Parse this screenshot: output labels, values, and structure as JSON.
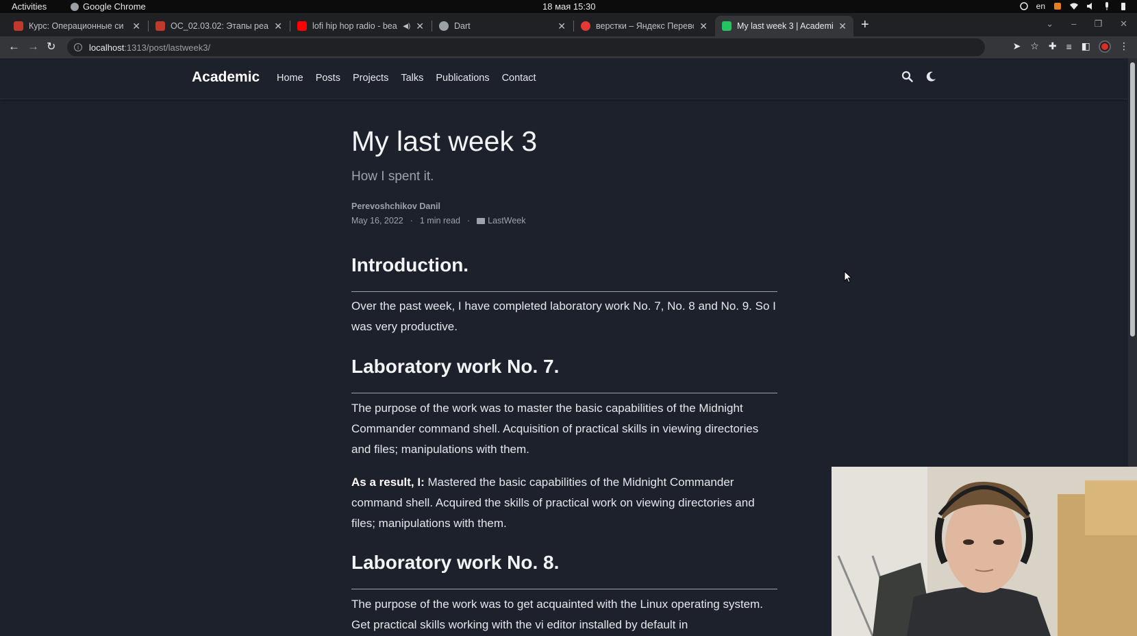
{
  "system": {
    "activities": "Activities",
    "app_name": "Google Chrome",
    "clock": "18 мая  15:30",
    "lang": "en"
  },
  "tabs": [
    {
      "title": "Курс: Операционные си",
      "fav_color": "#c0392b"
    },
    {
      "title": "ОС_02.03.02: Этапы реал",
      "fav_color": "#c0392b"
    },
    {
      "title": "lofi hip hop radio - bea",
      "fav_color": "#ff0000"
    },
    {
      "title": "Dart",
      "fav_color": "#9aa0a6"
    },
    {
      "title": "верстки – Яндекс Перево",
      "fav_color": "#e53935"
    },
    {
      "title": "My last week 3 | Academic",
      "fav_color": "#22c55e"
    }
  ],
  "address": {
    "host": "localhost",
    "path": ":1313/post/lastweek3/"
  },
  "site": {
    "brand": "Academic",
    "menu": [
      "Home",
      "Posts",
      "Projects",
      "Talks",
      "Publications",
      "Contact"
    ]
  },
  "article": {
    "title": "My last week 3",
    "subtitle": "How I spent it.",
    "author": "Perevoshchikov Danil",
    "date": "May 16, 2022",
    "read_time": "1 min read",
    "category": "LastWeek",
    "sections": [
      {
        "heading": "Introduction.",
        "paragraphs": [
          {
            "strong": "",
            "text": "Over the past week, I have completed laboratory work No. 7, No. 8 and No. 9. So I was very productive."
          }
        ]
      },
      {
        "heading": "Laboratory work No. 7.",
        "paragraphs": [
          {
            "strong": "",
            "text": "The purpose of the work was to master the basic capabilities of the Midnight Commander command shell. Acquisition of practical skills in viewing directories and files; manipulations with them."
          },
          {
            "strong": "As a result, I:",
            "text": " Mastered the basic capabilities of the Midnight Commander command shell. Acquired the skills of practical work on viewing directories and files; manipulations with them."
          }
        ]
      },
      {
        "heading": "Laboratory work No. 8.",
        "paragraphs": [
          {
            "strong": "",
            "text": "The purpose of the work was to get acquainted with the Linux operating system. Get practical skills working with the vi editor installed by default in"
          }
        ]
      }
    ]
  }
}
